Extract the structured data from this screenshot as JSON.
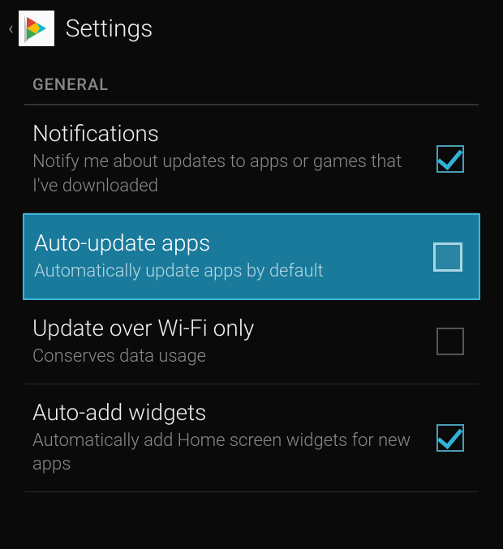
{
  "header": {
    "title": "Settings"
  },
  "section": {
    "label": "GENERAL"
  },
  "settings": [
    {
      "title": "Notifications",
      "description": "Notify me about updates to apps or games that I've downloaded",
      "checked": true,
      "highlighted": false
    },
    {
      "title": "Auto-update apps",
      "description": "Automatically update apps by default",
      "checked": false,
      "highlighted": true
    },
    {
      "title": "Update over Wi-Fi only",
      "description": "Conserves data usage",
      "checked": false,
      "highlighted": false
    },
    {
      "title": "Auto-add widgets",
      "description": "Automatically add Home screen widgets for new apps",
      "checked": true,
      "highlighted": false
    }
  ]
}
